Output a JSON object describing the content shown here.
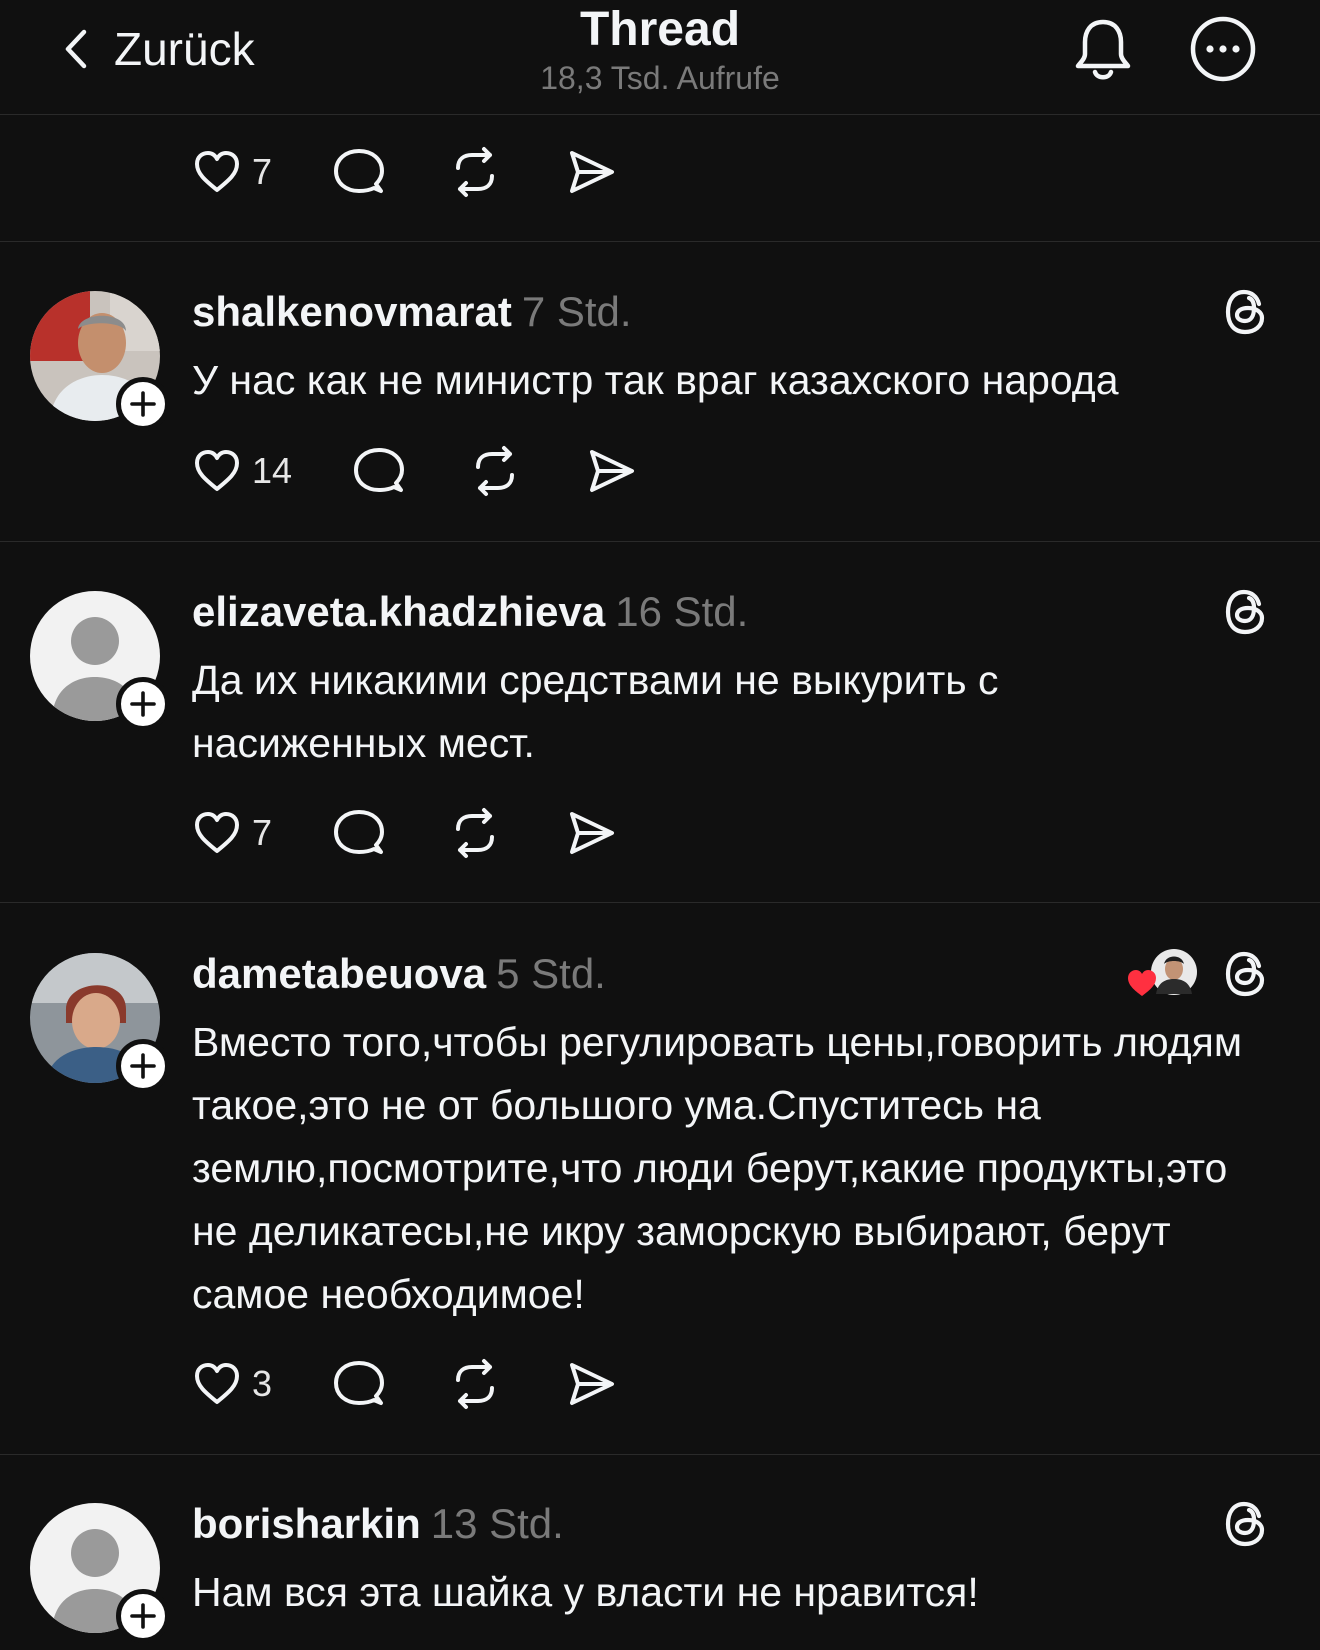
{
  "header": {
    "back_label": "Zurück",
    "title": "Thread",
    "views": "18,3 Tsd. Aufrufe"
  },
  "icons": {
    "back": "chevron-left-icon",
    "bell": "bell-icon",
    "more": "more-horizontal-icon",
    "like": "heart-icon",
    "reply": "speech-bubble-icon",
    "repost": "repost-icon",
    "share": "paper-plane-icon",
    "threads": "threads-logo-icon",
    "follow": "plus-icon"
  },
  "top_post": {
    "likes": "7"
  },
  "posts": [
    {
      "username": "shalkenovmarat",
      "time": "7 Std.",
      "text": "У нас как не министр так враг казахского народа",
      "likes": "14",
      "avatar": "photo"
    },
    {
      "username": "elizaveta.khadzhieva",
      "time": "16 Std.",
      "text": "Да их никакими средствами не выкурить с насиженных мест.",
      "likes": "7",
      "avatar": "default"
    },
    {
      "username": "dametabeuova",
      "time": "5 Std.",
      "text": "Вместо того,чтобы регулировать цены,говорить людям такое,это не от большого ума.Спуститесь на землю,посмотрите,что люди берут,какие продукты,это не деликатесы,не икру заморскую выбирают, берут самое необходимое!",
      "likes": "3",
      "avatar": "photo",
      "liked_by_author": true
    },
    {
      "username": "borisharkin",
      "time": "13 Std.",
      "text": "Нам вся эта шайка у власти не нравится!",
      "avatar": "default"
    }
  ],
  "colors": {
    "background": "#101010",
    "text": "#f3f5f7",
    "muted": "#7a7a7a",
    "divider": "#2a2a2a",
    "heart": "#ff3040"
  }
}
